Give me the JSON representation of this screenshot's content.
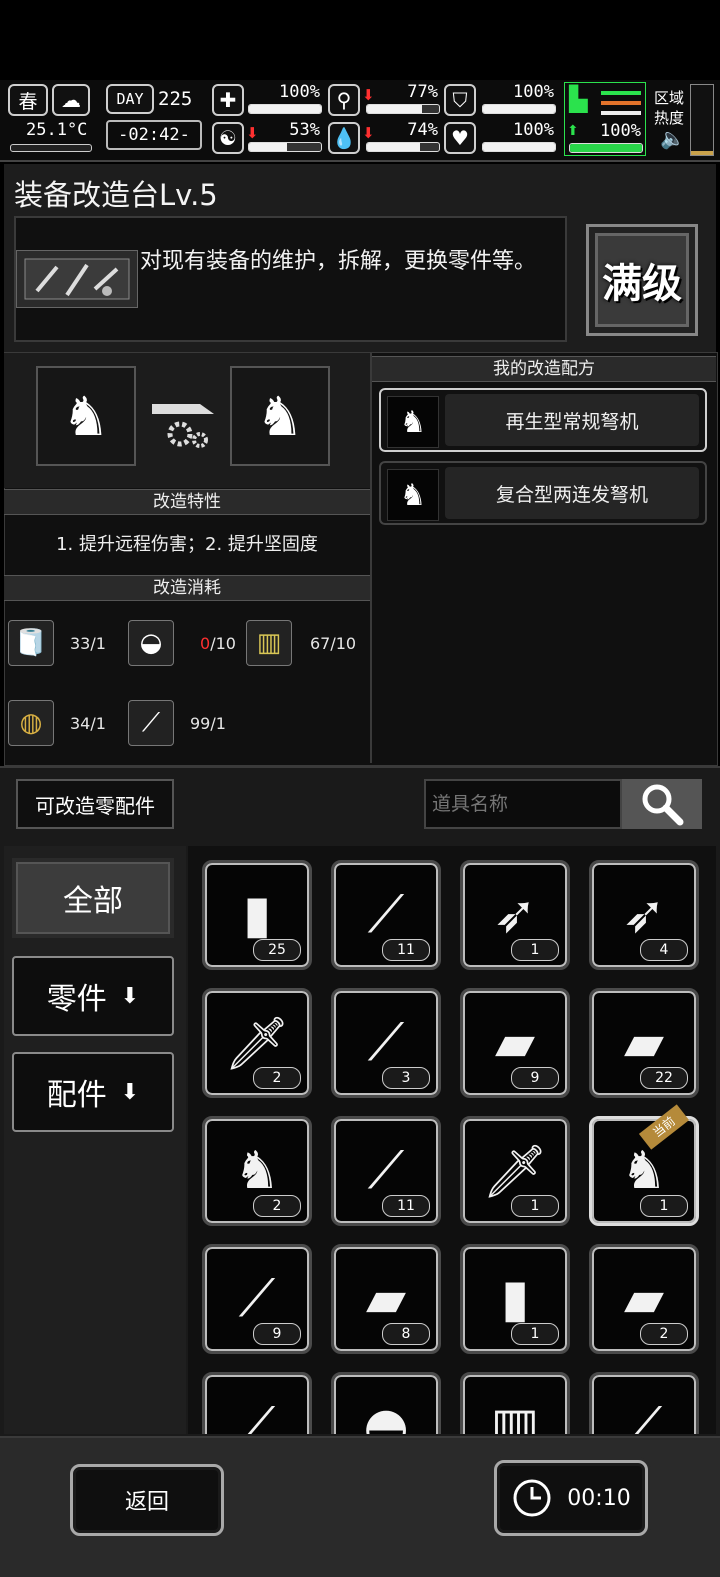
{
  "status": {
    "season": "春",
    "temperature": "25.1°C",
    "day_label": "DAY",
    "day_number": "225",
    "time": "-02:42-",
    "health": "100%",
    "health_level": 1.0,
    "hunger": "77%",
    "hunger_level": 0.77,
    "hunger_trend": "down",
    "armor": "100%",
    "armor_level": 1.0,
    "mind": "53%",
    "mind_level": 0.53,
    "mind_trend": "down",
    "water": "74%",
    "water_level": 0.74,
    "water_trend": "down",
    "heart": "100%",
    "heart_level": 1.0,
    "stamina": "100%",
    "stamina_level": 1.0,
    "stamina_trend": "up",
    "zone_heat_label": "区域热度"
  },
  "station": {
    "title": "装备改造台Lv.5",
    "description": "对现有装备的维护，拆解，更换零件等。",
    "max_level_label": "满级"
  },
  "modify": {
    "traits_header": "改造特性",
    "traits_text": "1. 提升远程伤害；2. 提升坚固度",
    "cost_header": "改造消耗",
    "costs": [
      {
        "icon": "cloth-roll-icon",
        "text": "33/1",
        "warn": ""
      },
      {
        "icon": "leather-icon",
        "text": "/10",
        "warn": "0"
      },
      {
        "icon": "wood-plank-icon",
        "text": "67/10",
        "warn": ""
      },
      {
        "icon": "rope-spool-icon",
        "text": "34/1",
        "warn": ""
      },
      {
        "icon": "screwdriver-icon",
        "text": "99/1",
        "warn": ""
      }
    ]
  },
  "recipes": {
    "header": "我的改造配方",
    "items": [
      {
        "label": "再生型常规弩机",
        "selected": true
      },
      {
        "label": "复合型两连发弩机",
        "selected": false
      }
    ]
  },
  "inventory": {
    "parts_button": "可改造零配件",
    "search_placeholder": "道具名称",
    "categories": [
      {
        "label": "全部",
        "selected": true
      },
      {
        "label": "零件",
        "selected": false
      },
      {
        "label": "配件",
        "selected": false
      }
    ],
    "current_tag": "当前",
    "items": [
      {
        "icon": "wrapped-grip-icon",
        "glyph": "▮",
        "count": "25"
      },
      {
        "icon": "curved-blade-icon",
        "glyph": "⟋",
        "count": "11"
      },
      {
        "icon": "spearhead-icon",
        "glyph": "➶",
        "count": "1"
      },
      {
        "icon": "serrated-spearhead-icon",
        "glyph": "➶",
        "count": "4"
      },
      {
        "icon": "dagger-blade-icon",
        "glyph": "🗡",
        "count": "2"
      },
      {
        "icon": "long-blade-icon",
        "glyph": "⟋",
        "count": "3"
      },
      {
        "icon": "short-tube-icon",
        "glyph": "▰",
        "count": "9"
      },
      {
        "icon": "long-tube-icon",
        "glyph": "▰",
        "count": "22"
      },
      {
        "icon": "trigger-mechanism-icon",
        "glyph": "♞",
        "count": "2"
      },
      {
        "icon": "thin-blade-icon",
        "glyph": "⟋",
        "count": "11"
      },
      {
        "icon": "sword-blade-icon",
        "glyph": "🗡",
        "count": "1"
      },
      {
        "icon": "crossbow-trigger-icon",
        "glyph": "♞",
        "count": "1",
        "current": true
      },
      {
        "icon": "katana-blade-icon",
        "glyph": "⟋",
        "count": "9"
      },
      {
        "icon": "wrapped-handle-icon",
        "glyph": "▰",
        "count": "8"
      },
      {
        "icon": "bristle-handle-icon",
        "glyph": "▮",
        "count": "1"
      },
      {
        "icon": "knife-handle-icon",
        "glyph": "▰",
        "count": "2"
      },
      {
        "icon": "rod-part-icon",
        "glyph": "⟋",
        "count": ""
      },
      {
        "icon": "helmet-icon",
        "glyph": "◓",
        "count": ""
      },
      {
        "icon": "vest-icon",
        "glyph": "▥",
        "count": ""
      },
      {
        "icon": "screw-part-icon",
        "glyph": "⟋",
        "count": ""
      }
    ]
  },
  "footer": {
    "back_label": "返回",
    "timer": "00:10"
  }
}
